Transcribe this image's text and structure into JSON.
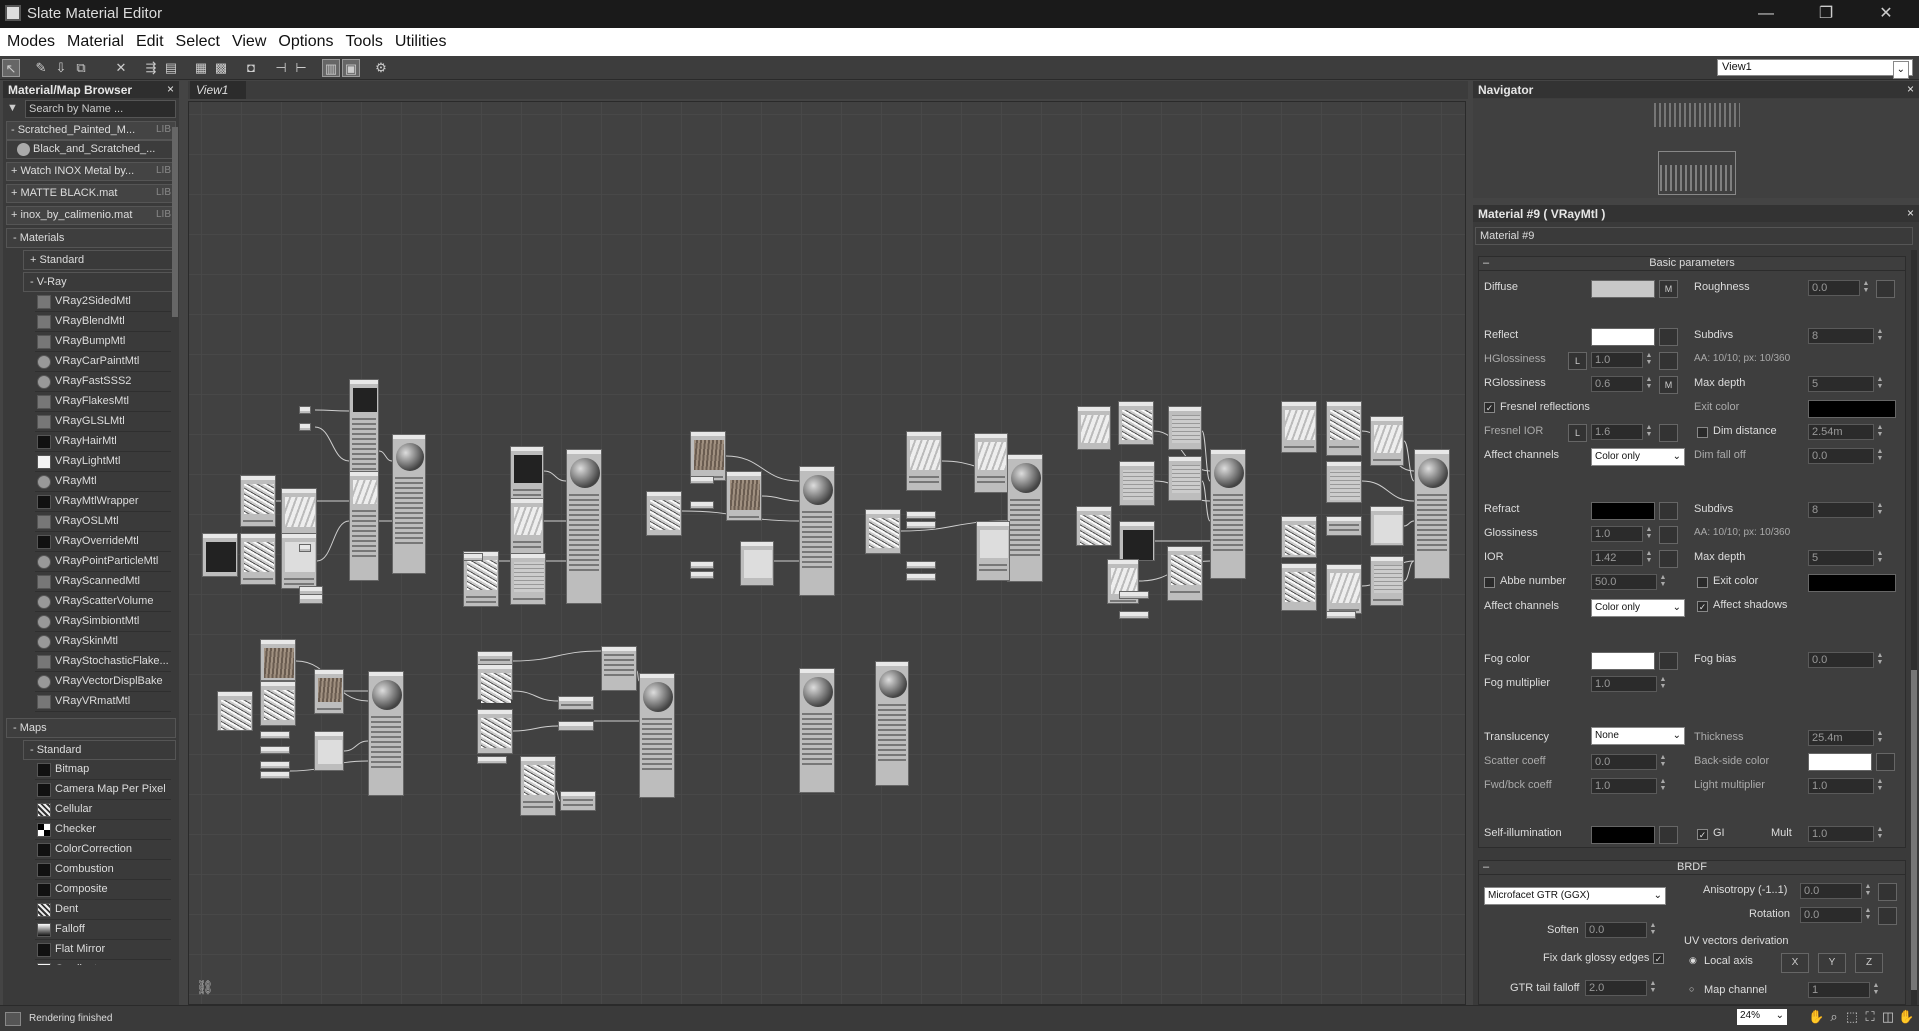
{
  "window": {
    "title": "Slate Material Editor",
    "minimize": "—",
    "restore": "❐",
    "close": "✕"
  },
  "menu": [
    "Modes",
    "Material",
    "Edit",
    "Select",
    "View",
    "Options",
    "Tools",
    "Utilities"
  ],
  "toolbar": {
    "view_select": "View1"
  },
  "browser": {
    "title": "Material/Map Browser",
    "close": "×",
    "search_placeholder": "Search by Name ...",
    "libraries": [
      {
        "label": "- Scratched_Painted_M...",
        "tag": "LIB"
      },
      {
        "label": "Black_and_Scratched_..."
      },
      {
        "label": "+ Watch INOX Metal by...",
        "tag": "LIB"
      },
      {
        "label": "+ MATTE BLACK.mat",
        "tag": "LIB"
      },
      {
        "label": "+ inox_by_calimenio.mat",
        "tag": "LIB"
      }
    ],
    "materials_header": "- Materials",
    "standard_group": "+ Standard",
    "vray_group": "- V-Ray",
    "vray_items": [
      {
        "label": "VRay2SidedMtl",
        "sw": "swg"
      },
      {
        "label": "VRayBlendMtl",
        "sw": "swg"
      },
      {
        "label": "VRayBumpMtl",
        "sw": "swg"
      },
      {
        "label": "VRayCarPaintMtl",
        "sw": "swd"
      },
      {
        "label": "VRayFastSSS2",
        "sw": "swd"
      },
      {
        "label": "VRayFlakesMtl",
        "sw": "swg"
      },
      {
        "label": "VRayGLSLMtl",
        "sw": "swg"
      },
      {
        "label": "VRayHairMtl",
        "sw": "swb"
      },
      {
        "label": "VRayLightMtl",
        "sw": "sww"
      },
      {
        "label": "VRayMtl",
        "sw": "swd"
      },
      {
        "label": "VRayMtlWrapper",
        "sw": "swb"
      },
      {
        "label": "VRayOSLMtl",
        "sw": "swg"
      },
      {
        "label": "VRayOverrideMtl",
        "sw": "swb"
      },
      {
        "label": "VRayPointParticleMtl",
        "sw": "swd"
      },
      {
        "label": "VRayScannedMtl",
        "sw": "swg"
      },
      {
        "label": "VRayScatterVolume",
        "sw": "swd"
      },
      {
        "label": "VRaySimbiontMtl",
        "sw": "swd"
      },
      {
        "label": "VRaySkinMtl",
        "sw": "swd"
      },
      {
        "label": "VRayStochasticFlake...",
        "sw": "swg"
      },
      {
        "label": "VRayVectorDisplBake",
        "sw": "swd"
      },
      {
        "label": "VRayVRmatMtl",
        "sw": "swg"
      }
    ],
    "maps_header": "- Maps",
    "maps_standard": "- Standard",
    "map_items": [
      {
        "label": "Bitmap",
        "sw": "swb"
      },
      {
        "label": "Camera Map Per Pixel",
        "sw": "swb"
      },
      {
        "label": "Cellular",
        "sw": "swn"
      },
      {
        "label": "Checker",
        "sw": "swc"
      },
      {
        "label": "ColorCorrection",
        "sw": "swb"
      },
      {
        "label": "Combustion",
        "sw": "swb"
      },
      {
        "label": "Composite",
        "sw": "swb"
      },
      {
        "label": "Dent",
        "sw": "swn"
      },
      {
        "label": "Falloff",
        "sw": "swf"
      },
      {
        "label": "Flat Mirror",
        "sw": "swb"
      },
      {
        "label": "Gradient",
        "sw": "swf"
      }
    ]
  },
  "view": {
    "tab": "View1"
  },
  "navigator": {
    "title": "Navigator",
    "close": "×"
  },
  "material": {
    "title": "Material #9  ( VRayMtl )",
    "close": "×",
    "name": "Material #9",
    "basic_header": "Basic parameters",
    "brdf_header": "BRDF",
    "collapse": "–",
    "diffuse": "Diffuse",
    "m": "M",
    "roughness": "Roughness",
    "roughness_val": "0.0",
    "reflect": "Reflect",
    "subdivs": "Subdivs",
    "subdivs_val": "8",
    "hgloss": "HGlossiness",
    "l": "L",
    "hgloss_val": "1.0",
    "aa": "AA: 10/10; px: 10/360",
    "rgloss": "RGlossiness",
    "rgloss_val": "0.6",
    "maxdepth": "Max depth",
    "maxdepth_val": "5",
    "fresnel": "Fresnel reflections",
    "exitcolor": "Exit color",
    "fresnel_ior": "Fresnel IOR",
    "fresnel_ior_val": "1.6",
    "dimdist": "Dim distance",
    "dimdist_val": "2.54m",
    "affect": "Affect channels",
    "coloronly": "Color only",
    "dimfall": "Dim fall off",
    "dimfall_val": "0.0",
    "refract": "Refract",
    "r_subdivs_val": "8",
    "glossiness": "Glossiness",
    "gloss_val": "1.0",
    "aa2": "AA: 10/10; px: 10/360",
    "ior": "IOR",
    "ior_val": "1.42",
    "r_maxdepth_val": "5",
    "abbe": "Abbe number",
    "abbe_val": "50.0",
    "r_exitcolor": "Exit color",
    "affect_shadows": "Affect shadows",
    "fogcolor": "Fog color",
    "fogbias": "Fog bias",
    "fogbias_val": "0.0",
    "fogmult": "Fog multiplier",
    "fogmult_val": "1.0",
    "translucency": "Translucency",
    "none": "None",
    "thickness": "Thickness",
    "thickness_val": "25.4m",
    "scatter": "Scatter coeff",
    "scatter_val": "0.0",
    "backside": "Back-side color",
    "fwdbck": "Fwd/bck coeff",
    "fwdbck_val": "1.0",
    "lightmult": "Light multiplier",
    "lightmult_val": "1.0",
    "selfillum": "Self-illumination",
    "gi": "GI",
    "mult": "Mult",
    "mult_val": "1.0",
    "brdf_type": "Microfacet GTR (GGX)",
    "aniso": "Anisotropy (-1..1)",
    "aniso_val": "0.0",
    "rotation": "Rotation",
    "rotation_val": "0.0",
    "soften": "Soften",
    "soften_val": "0.0",
    "uvderiv": "UV vectors derivation",
    "fixdark": "Fix dark glossy edges",
    "localaxis": "Local axis",
    "x": "X",
    "y": "Y",
    "z": "Z",
    "gtr": "GTR tail falloff",
    "gtr_val": "2.0",
    "mapchannel": "Map channel",
    "mapchannel_val": "1",
    "check": "✓"
  },
  "status": {
    "text": "Rendering finished",
    "zoom": "24%"
  },
  "colors": {
    "title_bg": "#1a1a1a",
    "panel_bg": "#3a3a3a",
    "view_bg": "#414141"
  }
}
